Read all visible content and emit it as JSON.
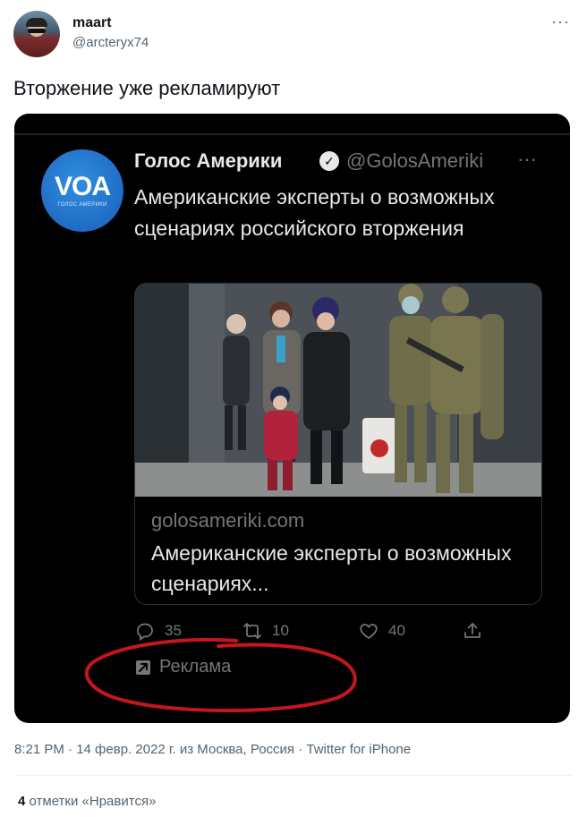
{
  "author": {
    "display_name": "maart",
    "handle": "@arcteryx74"
  },
  "tweet_text": "Вторжение уже рекламируют",
  "embedded": {
    "logo_mark": "VOA",
    "logo_sub": "ГОЛОС АМЕРИКИ",
    "name": "Голос Америки",
    "verified_mark": "✓",
    "handle": "@GolosAmeriki",
    "more": "···",
    "text": "Американские эксперты о возможных сценариях российского вторжения",
    "card": {
      "domain": "golosameriki.com",
      "title": "Американские эксперты о возможных сценариях..."
    },
    "actions": {
      "replies": "35",
      "retweets": "10",
      "likes": "40"
    },
    "promoted_label": "Реклама"
  },
  "meta_line": "8:21 PM · 14 февр. 2022 г. из Москва, Россия · Twitter for iPhone",
  "likes_summary": {
    "count": "4",
    "label": "отметки «Нравится»"
  },
  "more_label": "···",
  "icons": [
    "more-icon",
    "verified-icon",
    "reply-icon",
    "retweet-icon",
    "like-icon",
    "share-icon",
    "promoted-icon"
  ],
  "colors": {
    "annotation_ring": "#c4161c",
    "dark_bg": "#000000",
    "muted_text": "#71767b"
  }
}
